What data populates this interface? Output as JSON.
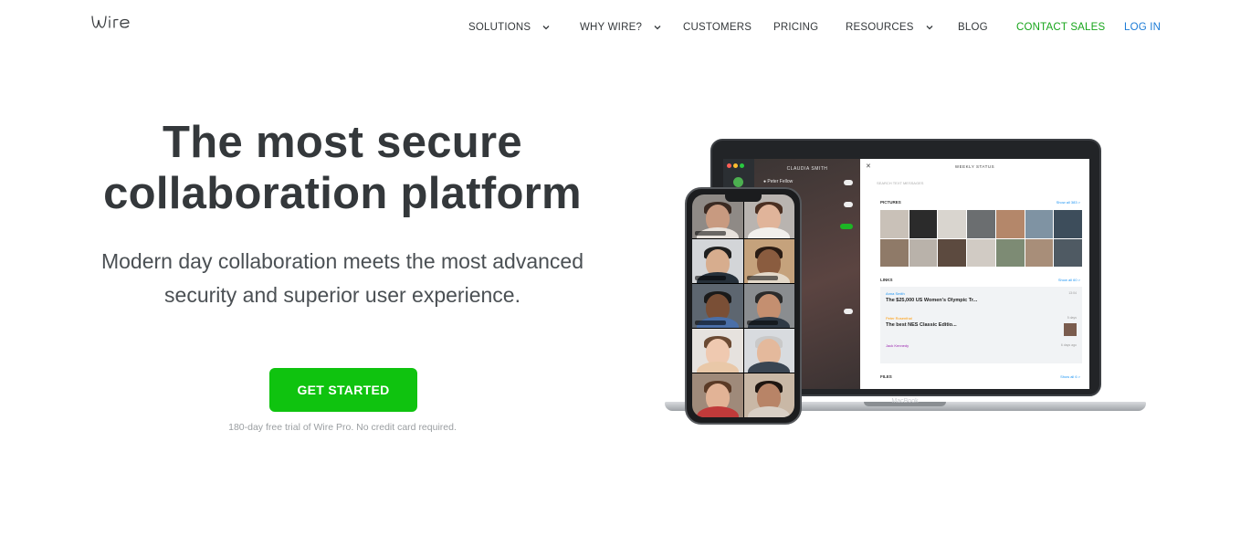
{
  "header": {
    "logo_text": "wire",
    "nav": [
      {
        "label": "SOLUTIONS",
        "has_dropdown": true
      },
      {
        "label": "WHY WIRE?",
        "has_dropdown": true
      },
      {
        "label": "CUSTOMERS",
        "has_dropdown": false
      },
      {
        "label": "PRICING",
        "has_dropdown": false
      },
      {
        "label": "RESOURCES",
        "has_dropdown": true
      },
      {
        "label": "BLOG",
        "has_dropdown": false
      },
      {
        "label": "CONTACT SALES",
        "has_dropdown": false
      },
      {
        "label": "LOG IN",
        "has_dropdown": false
      }
    ],
    "colors": {
      "contact_sales": "#17a51b",
      "log_in": "#1c7bd6"
    }
  },
  "hero": {
    "title_line1": "The most secure",
    "title_line2": "collaboration platform",
    "subtitle_line1": "Modern day collaboration meets the most advanced",
    "subtitle_line2": "security and superior user experience.",
    "cta_label": "GET STARTED",
    "cta_color": "#0fc30f",
    "cta_note": "180-day free trial of Wire Pro. No credit card required."
  },
  "laptop_mockup": {
    "brand": "MacBook",
    "chat_header": "CLAUDIA SMITH",
    "chat_contact": "Peter Fellow",
    "panel_header": "WEEKLY STATUS",
    "search_placeholder": "SEARCH TEXT MESSAGES",
    "pictures_label": "PICTURES",
    "pictures_show_all": "Show all 383 >",
    "links_label": "LINKS",
    "links_show_all": "Show all 60 >",
    "files_label": "FILES",
    "files_show_all": "Show all 6 >",
    "links": [
      {
        "author": "Anna Smith",
        "title": "The $25,000 US Women's Olympic Tr...",
        "time": "13:04"
      },
      {
        "author": "Peter Rosenthal",
        "title": "The best NES Classic Editio...",
        "time": "5 days"
      },
      {
        "author": "Jack Kennedy",
        "title": "",
        "time": "6 days ago"
      }
    ]
  },
  "phone_mockup": {
    "participants": 10
  }
}
